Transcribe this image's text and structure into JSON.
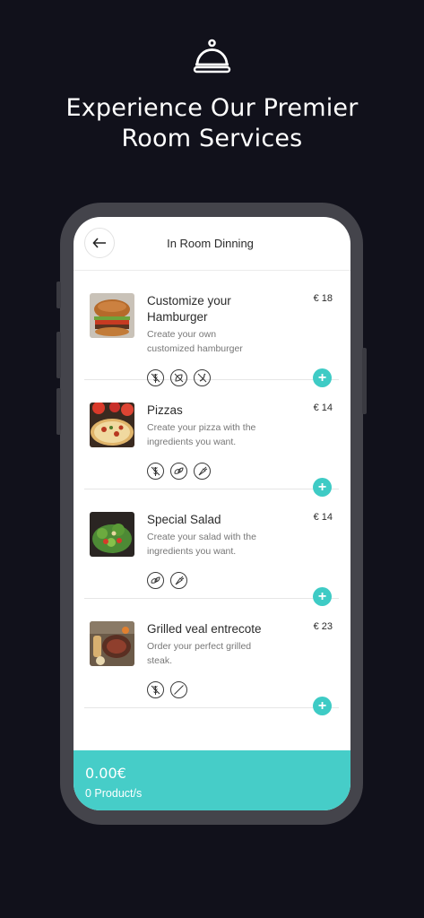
{
  "hero": {
    "icon": "cloche-icon",
    "title_line1": "Experience Our Premier",
    "title_line2": "Room Services"
  },
  "header": {
    "back_icon": "arrow-left-icon",
    "title": "In Room Dinning"
  },
  "items": [
    {
      "name_line1": "Customize your",
      "name_line2": "Hamburger",
      "desc_line1": "Create your own",
      "desc_line2": "customized hamburger",
      "price": "€ 18",
      "image": "hamburger-photo",
      "allergen_icons": [
        "no-gluten-icon",
        "no-vegan-icon",
        "no-spicy-icon"
      ]
    },
    {
      "name_line1": "Pizzas",
      "desc_line1": "Create your pizza with the",
      "desc_line2": "ingredients you want.",
      "price": "€ 14",
      "image": "pizza-photo",
      "allergen_icons": [
        "no-gluten-icon",
        "vegan-icon",
        "vegetable-icon"
      ]
    },
    {
      "name_line1": "Special Salad",
      "desc_line1": "Create your salad with the",
      "desc_line2": "ingredients you want.",
      "price": "€ 14",
      "image": "salad-photo",
      "allergen_icons": [
        "vegan-icon",
        "vegetable-icon"
      ]
    },
    {
      "name_line1": "Grilled veal entrecote",
      "desc_line1": "Order your perfect grilled",
      "desc_line2": "steak.",
      "price": "€ 23",
      "image": "steak-photo",
      "allergen_icons": [
        "no-gluten-icon",
        "prohibited-icon"
      ]
    }
  ],
  "add_label": "+",
  "cart": {
    "total": "0.00€",
    "count": "0 Product/s"
  },
  "colors": {
    "background": "#11111b",
    "accent": "#3ecbc5",
    "cart_bar": "#46cdc8",
    "phone_frame": "#44444b"
  }
}
